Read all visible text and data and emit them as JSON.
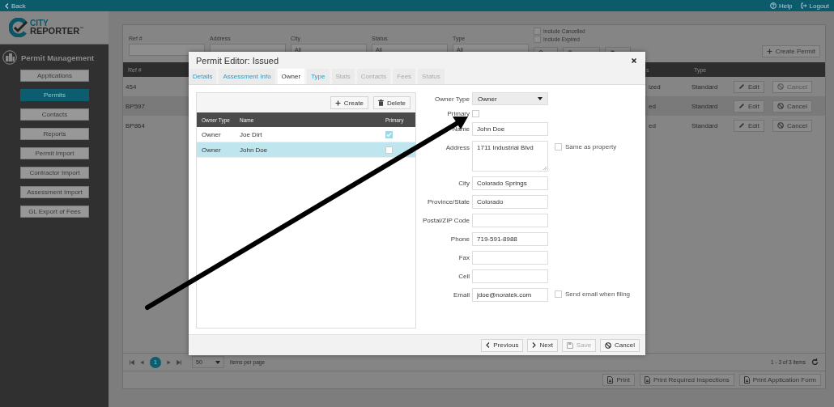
{
  "top_bar": {
    "back": "Back",
    "help": "Help",
    "logout": "Logout"
  },
  "logo": {
    "city": "CITY",
    "reporter": "REPORTER",
    "tm": "™"
  },
  "sidebar": {
    "heading": "Permit Management",
    "items": [
      {
        "label": "Applications",
        "selected": false
      },
      {
        "label": "Permits",
        "selected": true
      },
      {
        "label": "Contacts",
        "selected": false
      },
      {
        "label": "Reports",
        "selected": false
      },
      {
        "label": "Permit Import",
        "selected": false
      },
      {
        "label": "Contractor Import",
        "selected": false
      },
      {
        "label": "Assessment Import",
        "selected": false
      },
      {
        "label": "GL Export of Fees",
        "selected": false
      }
    ]
  },
  "filters": {
    "fields": [
      {
        "label": "Ref #",
        "kind": "text"
      },
      {
        "label": "Address",
        "kind": "text"
      },
      {
        "label": "City",
        "kind": "select",
        "value": "All"
      },
      {
        "label": "Status",
        "kind": "select",
        "value": "All"
      },
      {
        "label": "Type",
        "kind": "select",
        "value": "All"
      }
    ],
    "checkboxes": [
      {
        "label": "Include Cancelled",
        "checked": false
      },
      {
        "label": "Include Expired",
        "checked": false
      }
    ],
    "create": "Create Permit"
  },
  "table": {
    "columns": [
      {
        "label": "Ref #"
      },
      {
        "label": "s"
      },
      {
        "label": "Type"
      }
    ],
    "rows": [
      {
        "ref": "454",
        "status": "ized",
        "type": "Standard",
        "edit": "Edit",
        "cancel": "Cancel",
        "cancel_disabled": true
      },
      {
        "ref": "BP597",
        "status": "ed",
        "type": "Standard",
        "edit": "Edit",
        "cancel": "Cancel",
        "cancel_disabled": false
      },
      {
        "ref": "BP864",
        "status": "ed",
        "type": "Standard",
        "edit": "Edit",
        "cancel": "Cancel",
        "cancel_disabled": false
      }
    ]
  },
  "pager": {
    "page": "1",
    "page_size": "50",
    "per_page_label": "items per page",
    "summary": "1 - 3 of 3 items"
  },
  "print_buttons": [
    "Print",
    "Print Required Inspections",
    "Print Application Form"
  ],
  "modal": {
    "title": "Permit Editor: Issued",
    "tabs": [
      {
        "label": "Details",
        "selected": false,
        "disabled": false
      },
      {
        "label": "Assessment Info",
        "selected": false,
        "disabled": false
      },
      {
        "label": "Owner",
        "selected": true,
        "disabled": false
      },
      {
        "label": "Type",
        "selected": false,
        "disabled": false
      },
      {
        "label": "Stats",
        "selected": false,
        "disabled": true
      },
      {
        "label": "Contacts",
        "selected": false,
        "disabled": true
      },
      {
        "label": "Fees",
        "selected": false,
        "disabled": true
      },
      {
        "label": "Status",
        "selected": false,
        "disabled": true
      }
    ],
    "owners": {
      "create": "Create",
      "delete": "Delete",
      "columns": [
        "Owner Type",
        "Name",
        "Primary"
      ],
      "rows": [
        {
          "owner_type": "Owner",
          "name": "Joe Dirt",
          "primary": true,
          "selected": false
        },
        {
          "owner_type": "Owner",
          "name": "John Doe",
          "primary": false,
          "selected": true
        }
      ]
    },
    "form": [
      {
        "label": "Owner Type",
        "kind": "select",
        "value": "Owner"
      },
      {
        "label": "Primary",
        "kind": "checkbox",
        "checked": false
      },
      {
        "label": "Name",
        "kind": "text",
        "value": "John Doe"
      },
      {
        "label": "Address",
        "kind": "textarea",
        "value": "1711 Industrial Blvd",
        "option": {
          "label": "Same as property",
          "checked": false
        }
      },
      {
        "label": "City",
        "kind": "text",
        "value": "Colorado Springs"
      },
      {
        "label": "Province/State",
        "kind": "text",
        "value": "Colorado"
      },
      {
        "label": "Postal/ZIP Code",
        "kind": "text"
      },
      {
        "label": "Phone",
        "kind": "text",
        "value": "719-591-8988"
      },
      {
        "label": "Fax",
        "kind": "text"
      },
      {
        "label": "Cell",
        "kind": "text"
      },
      {
        "label": "Email",
        "kind": "text",
        "value": "jdoe@noratek.com",
        "option": {
          "label": "Send email when filing",
          "checked": false
        }
      }
    ],
    "footer": {
      "previous": "Previous",
      "next": "Next",
      "save": {
        "label": "Save",
        "disabled": true
      },
      "cancel": "Cancel"
    }
  }
}
